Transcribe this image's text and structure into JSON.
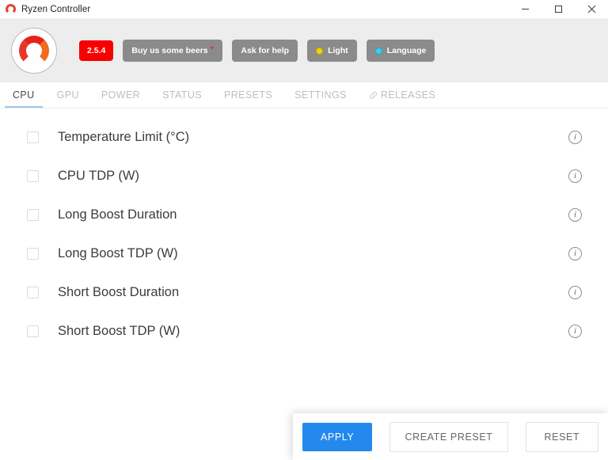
{
  "window": {
    "title": "Ryzen Controller",
    "app_icon": "ryzen-logo-icon",
    "controls": {
      "minimize": "minimize-icon",
      "maximize": "maximize-icon",
      "close": "close-icon"
    }
  },
  "header": {
    "logo_icon": "ryzen-logo-icon",
    "version": "2.5.4",
    "buttons": [
      {
        "label": "Buy us some beers",
        "icon": "heart-icon"
      },
      {
        "label": "Ask for help",
        "icon": ""
      },
      {
        "label": "Light",
        "icon": "sun-icon"
      },
      {
        "label": "Language",
        "icon": "globe-icon"
      }
    ],
    "colors": {
      "version_badge": "#f70000",
      "toolbar_button": "#8b8b8b",
      "header_bg": "#ededed",
      "heart": "#e0392b",
      "sun": "#f5d000",
      "globe": "#35d2f5"
    }
  },
  "tabs": {
    "active": "CPU",
    "underline_color": "#9ec7ec",
    "items": [
      {
        "label": "CPU",
        "icon": ""
      },
      {
        "label": "GPU",
        "icon": ""
      },
      {
        "label": "POWER",
        "icon": ""
      },
      {
        "label": "STATUS",
        "icon": ""
      },
      {
        "label": "PRESETS",
        "icon": ""
      },
      {
        "label": "SETTINGS",
        "icon": ""
      },
      {
        "label": "RELEASES",
        "icon": "link-icon"
      }
    ]
  },
  "settings": {
    "rows": [
      {
        "label": "Temperature Limit (°C)",
        "checked": false,
        "info_icon": "info-icon"
      },
      {
        "label": "CPU TDP (W)",
        "checked": false,
        "info_icon": "info-icon"
      },
      {
        "label": "Long Boost Duration",
        "checked": false,
        "info_icon": "info-icon"
      },
      {
        "label": "Long Boost TDP (W)",
        "checked": false,
        "info_icon": "info-icon"
      },
      {
        "label": "Short Boost Duration",
        "checked": false,
        "info_icon": "info-icon"
      },
      {
        "label": "Short Boost TDP (W)",
        "checked": false,
        "info_icon": "info-icon"
      }
    ]
  },
  "actions": {
    "apply": "APPLY",
    "create_preset": "CREATE PRESET",
    "reset": "RESET",
    "apply_color": "#2489ec"
  }
}
